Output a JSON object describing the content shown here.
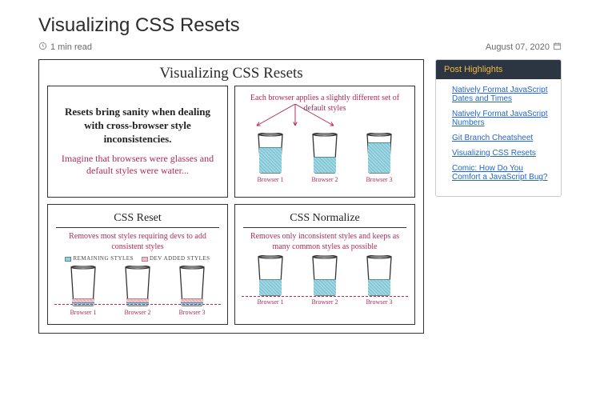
{
  "header": {
    "title": "Visualizing CSS Resets",
    "read_time": "1 min read",
    "date": "August 07, 2020"
  },
  "illustration": {
    "title": "Visualizing CSS Resets",
    "panel1": {
      "lead": "Resets bring sanity when dealing with cross-browser style inconsistencies.",
      "sub": "Imagine that browsers were glasses and default styles were water..."
    },
    "panel2": {
      "desc": "Each browser applies a slightly different set of default styles",
      "glass1": "Browser 1",
      "glass2": "Browser 2",
      "glass3": "Browser 3"
    },
    "panel3": {
      "heading": "CSS Reset",
      "desc": "Removes most styles requiring devs to add consistent styles",
      "legend_a": "REMAINING STYLES",
      "legend_b": "DEV ADDED STYLES",
      "glass1": "Browser 1",
      "glass2": "Browser 2",
      "glass3": "Browser 3"
    },
    "panel4": {
      "heading": "CSS Normalize",
      "desc": "Removes only inconsistent styles and keeps as many common styles as possible",
      "glass1": "Browser 1",
      "glass2": "Browser 2",
      "glass3": "Browser 3"
    }
  },
  "sidebar": {
    "title": "Post Highlights",
    "links": [
      "Natively Format JavaScript Dates and Times",
      "Natively Format JavaScript Numbers",
      "Git Branch Cheatsheet",
      "Visualizing CSS Resets",
      "Comic: How Do You Comfort a JavaScript Bug?"
    ]
  }
}
